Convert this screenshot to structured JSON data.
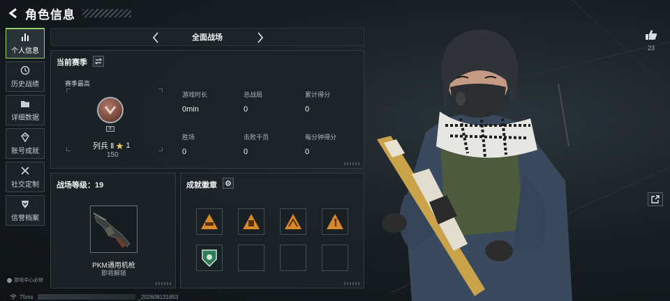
{
  "header": {
    "title": "角色信息"
  },
  "sidebar": {
    "items": [
      {
        "label": "个人信息",
        "icon": "bar-chart-icon",
        "active": true
      },
      {
        "label": "历史战绩",
        "icon": "history-clock-icon"
      },
      {
        "label": "详细数据",
        "icon": "folder-icon"
      },
      {
        "label": "账号成就",
        "icon": "achievement-crest-icon"
      },
      {
        "label": "社交定制",
        "icon": "wrench-tools-icon"
      },
      {
        "label": "信誉档案",
        "icon": "shield-chevron-icon"
      }
    ],
    "support": "游戏中心必修"
  },
  "mode": {
    "name": "全面战场"
  },
  "season": {
    "title": "当前赛季",
    "highest_label": "赛季最高",
    "rank_name": "列兵 Ⅱ",
    "rank_stars": "1",
    "rank_score": "150",
    "rank_sub": "II",
    "stats": [
      {
        "label": "游戏时长",
        "value": "0min"
      },
      {
        "label": "总战局",
        "value": "0"
      },
      {
        "label": "累计得分",
        "value": "0"
      },
      {
        "label": "胜场",
        "value": "0"
      },
      {
        "label": "击败干员",
        "value": "0"
      },
      {
        "label": "每分钟得分",
        "value": "0"
      }
    ]
  },
  "level": {
    "title": "战场等级：19",
    "weapon_name": "PKM通用机枪",
    "weapon_status": "即将解锁"
  },
  "badges": {
    "title": "成就徽章"
  },
  "social": {
    "like_count": "23"
  },
  "status": {
    "ping": "75ms",
    "id_suffix": "_202608131853"
  },
  "colors": {
    "accent": "#8fd16b",
    "badge_orange": "#d9892c"
  }
}
